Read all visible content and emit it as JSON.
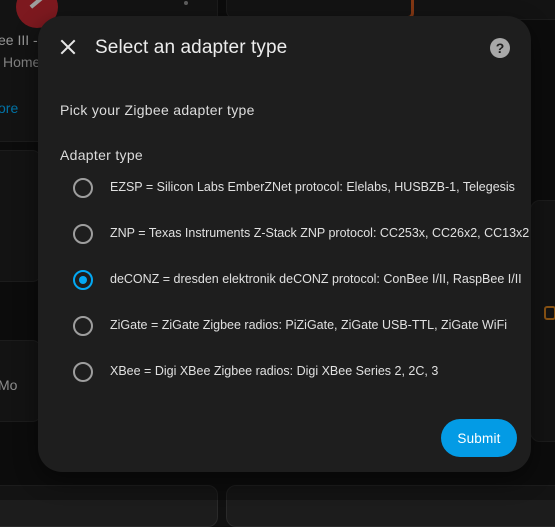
{
  "background": {
    "card_title": "ee III -",
    "card_subtitle": "Home",
    "card_link": "ore",
    "side_text": "Mo"
  },
  "dialog": {
    "title": "Select an adapter type",
    "close_icon": "close-icon",
    "help_icon": "help-circle-icon",
    "help_glyph": "?",
    "description": "Pick your Zigbee adapter type",
    "field_label": "Adapter type",
    "options": [
      {
        "label": "EZSP = Silicon Labs EmberZNet protocol: Elelabs, HUSBZB-1, Telegesis",
        "selected": false
      },
      {
        "label": "ZNP = Texas Instruments Z-Stack ZNP protocol: CC253x, CC26x2, CC13x2",
        "selected": false
      },
      {
        "label": "deCONZ = dresden elektronik deCONZ protocol: ConBee I/II, RaspBee I/II",
        "selected": true
      },
      {
        "label": "ZiGate = ZiGate Zigbee radios: PiZiGate, ZiGate USB-TTL, ZiGate WiFi",
        "selected": false
      },
      {
        "label": "XBee = Digi XBee Zigbee radios: Digi XBee Series 2, 2C, 3",
        "selected": false
      }
    ],
    "submit_label": "Submit"
  },
  "colors": {
    "accent": "#03a9f4",
    "button": "#039be5",
    "dialog_bg": "#1e1e1e"
  }
}
